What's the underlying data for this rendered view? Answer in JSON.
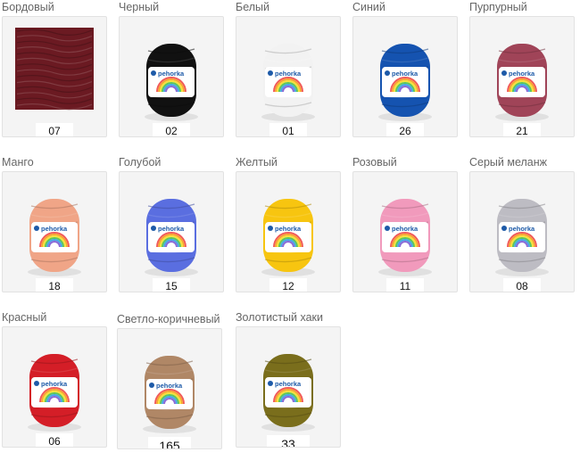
{
  "colors": [
    {
      "name": "Бордовый",
      "code": "07",
      "color": "#6b1a22",
      "style": "texture"
    },
    {
      "name": "Черный",
      "code": "02",
      "color": "#111111",
      "style": "ball"
    },
    {
      "name": "Белый",
      "code": "01",
      "color": "#f2f2f2",
      "style": "ball"
    },
    {
      "name": "Синий",
      "code": "26",
      "color": "#1553b0",
      "style": "ball"
    },
    {
      "name": "Пурпурный",
      "code": "21",
      "color": "#a04458",
      "style": "ball"
    },
    {
      "name": "Манго",
      "code": "18",
      "color": "#f0a587",
      "style": "ball"
    },
    {
      "name": "Голубой",
      "code": "15",
      "color": "#5a6ee0",
      "style": "ball"
    },
    {
      "name": "Желтый",
      "code": "12",
      "color": "#f7c510",
      "style": "ball"
    },
    {
      "name": "Розовый",
      "code": "11",
      "color": "#f19abc",
      "style": "ball"
    },
    {
      "name": "Серый меланж",
      "code": "08",
      "color": "#bdbcc3",
      "style": "ball"
    },
    {
      "name": "Красный",
      "code": "06",
      "color": "#d41e27",
      "style": "ball"
    },
    {
      "name": "Светло-коричневый",
      "code": "165",
      "color": "#b08766",
      "style": "ball"
    },
    {
      "name": "Золотистый хаки",
      "code": "33",
      "color": "#7a6e1c",
      "style": "ball"
    }
  ],
  "label": {
    "brand": "pehorka"
  }
}
